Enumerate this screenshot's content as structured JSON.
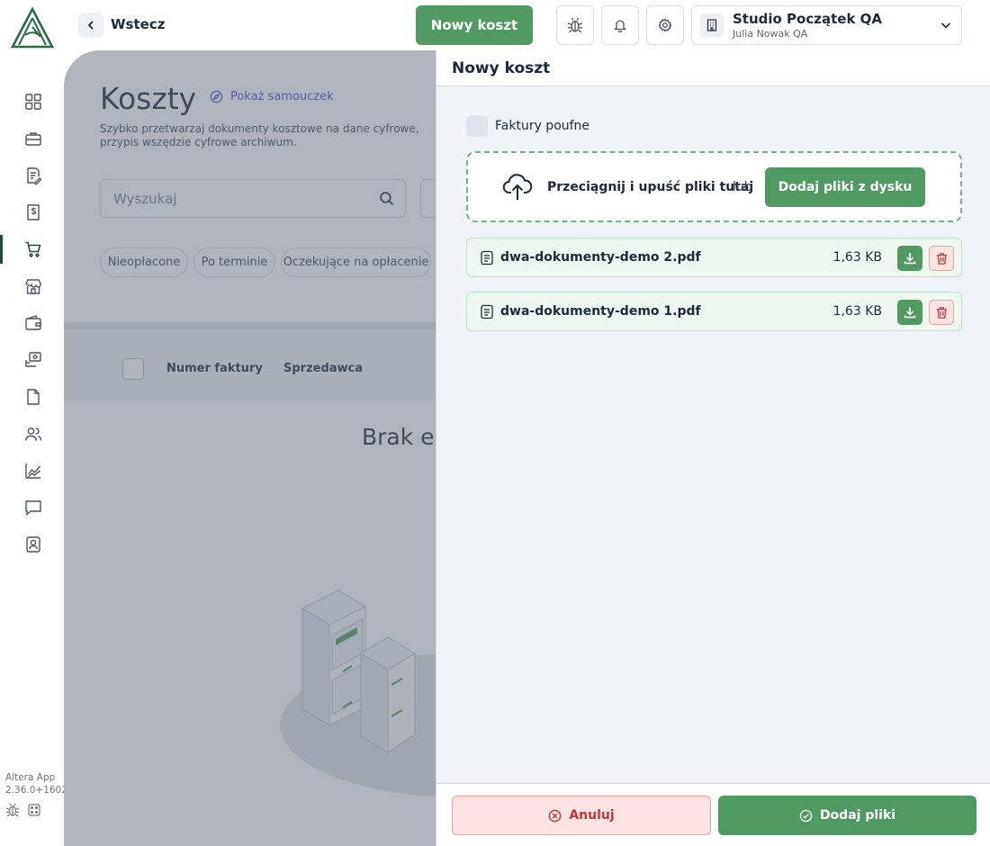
{
  "app": {
    "version_label": "Altera App",
    "version_number": "2.36.0+1602"
  },
  "topbar": {
    "back_label": "Wstecz",
    "new_cost_label": "Nowy koszt",
    "company_name": "Studio Początek QA",
    "company_user": "Julia Nowak QA"
  },
  "sidebar": {
    "items": [
      {
        "icon": "dashboard-grid-icon",
        "active": false
      },
      {
        "icon": "briefcase-icon",
        "active": false
      },
      {
        "icon": "document-edit-icon",
        "active": false
      },
      {
        "icon": "invoice-dollar-icon",
        "active": false
      },
      {
        "icon": "shopping-cart-icon",
        "active": true
      },
      {
        "icon": "store-icon",
        "active": false
      },
      {
        "icon": "wallet-icon",
        "active": false
      },
      {
        "icon": "money-transfer-icon",
        "active": false
      },
      {
        "icon": "file-icon",
        "active": false
      },
      {
        "icon": "users-icon",
        "active": false
      },
      {
        "icon": "chart-line-icon",
        "active": false
      },
      {
        "icon": "chat-icon",
        "active": false
      },
      {
        "icon": "contact-card-icon",
        "active": false
      }
    ]
  },
  "page": {
    "title": "Koszty",
    "tutorial_label": "Pokaż samouczek",
    "description": "Szybko przetwarzaj dokumenty kosztowe na dane cyfrowe, przypis wszędzie cyfrowe archiwum.",
    "search_placeholder": "Wyszukaj",
    "filters": [
      "Nieopłacone",
      "Po terminie",
      "Oczekujące na opłacenie"
    ],
    "columns": [
      "Numer faktury",
      "Sprzedawca"
    ],
    "empty_title": "Brak ele"
  },
  "drawer": {
    "title": "Nowy koszt",
    "confidential_label": "Faktury poufne",
    "dropzone_text": "Przeciągnij i upuść pliki tutaj",
    "dropzone_or": "lub",
    "dropzone_button": "Dodaj pliki z dysku",
    "files": [
      {
        "name": "dwa-dokumenty-demo 2.pdf",
        "size": "1,63 KB"
      },
      {
        "name": "dwa-dokumenty-demo 1.pdf",
        "size": "1,63 KB"
      }
    ],
    "cancel_label": "Anuluj",
    "submit_label": "Dodaj pliki"
  },
  "colors": {
    "primary_green": "#4f9a62",
    "danger_red": "#c0393b",
    "text_dark": "#1c2a3a"
  }
}
